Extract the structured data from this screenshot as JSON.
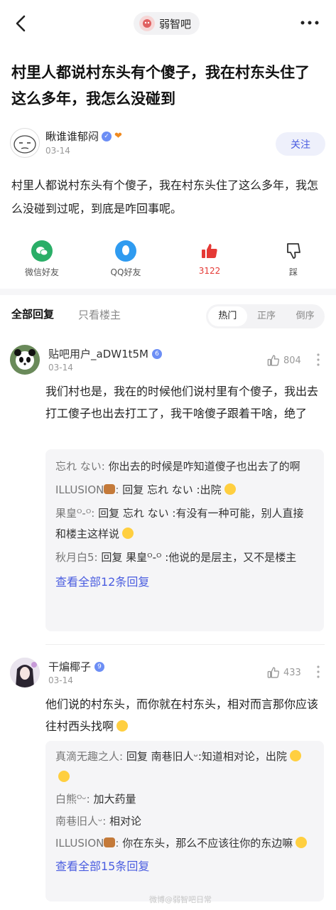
{
  "nav": {
    "forum_name": "弱智吧"
  },
  "post": {
    "title": "村里人都说村东头有个傻子，我在村东头住了这么多年，我怎么没碰到",
    "author": "瞅谁谁郁闷",
    "date": "03-14",
    "follow_label": "关注",
    "body": "村里人都说村东头有个傻子，我在村东头住了这么多年，我怎么没碰到过呢，到底是咋回事呢。"
  },
  "share": {
    "wechat": "微信好友",
    "qq": "QQ好友",
    "likes": "3122",
    "dislike": "踩"
  },
  "tabs": {
    "all": "全部回复",
    "op_only": "只看楼主",
    "sort": [
      "热门",
      "正序",
      "倒序"
    ]
  },
  "comments": [
    {
      "user": "贴吧用户_aDW1t5M",
      "date": "03-14",
      "likes": "804",
      "text": "我们村也是，我在的时候他们说村里有个傻子，我出去打工傻子也出去打工了，我干啥傻子跟着干啥，绝了",
      "replies": [
        {
          "name": "忘れ ない:",
          "text": "你出去的时候是咋知道傻子也出去了的啊"
        },
        {
          "name": "ILLUSION",
          "name_suffix": ":",
          "text": "回复 忘れ ない :出院"
        },
        {
          "name": "果皇ᴼ-ᴼ:",
          "text": "回复 忘れ ない :有没有一种可能，别人直接和楼主这样说"
        },
        {
          "name": "秋月白5:",
          "text": "回复 果皇ᴼ-ᴼ :他说的是层主，又不是楼主"
        }
      ],
      "view_all": "查看全部12条回复"
    },
    {
      "user": "干煸椰子",
      "date": "03-14",
      "likes": "433",
      "text": "他们说的村东头，而你就在村东头，相对而言那你应该往村西头找啊",
      "replies": [
        {
          "name": "真滴无趣之人:",
          "text": "回复 南巷旧人ᵕ:知道相对论，出院"
        },
        {
          "name": "白熊ᴼᵕ:",
          "text": "加大药量"
        },
        {
          "name": "南巷旧人ᵕ:",
          "text": "相对论"
        },
        {
          "name": "ILLUSION",
          "name_suffix": ":",
          "text": "你在东头，那么不应该往你的东边嘛"
        }
      ],
      "view_all": "查看全部15条回复"
    }
  ],
  "watermark": "微博@弱智吧日常",
  "colors": {
    "accent": "#4a5de0",
    "like_red": "#e53935",
    "wechat": "#2aae67",
    "qq": "#2f9bf0"
  }
}
